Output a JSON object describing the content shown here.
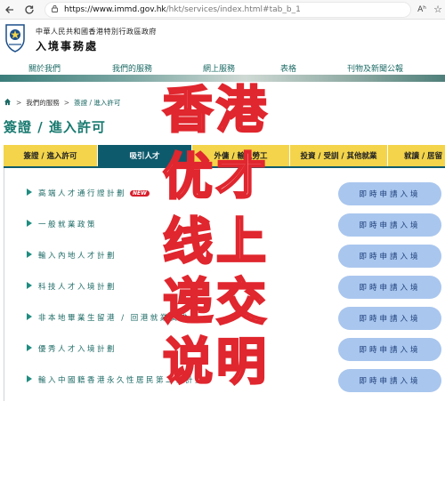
{
  "browser": {
    "url_host": "https://www.immd.gov.hk",
    "url_path": "/hkt/services/index.html#tab_b_1",
    "read_aloud_label": "Aʰ",
    "back_icon": "back-arrow-icon",
    "refresh_icon": "refresh-icon",
    "lock_icon": "lock-icon"
  },
  "header": {
    "government_name": "中華人民共和國香港特別行政區政府",
    "department_name": "入境事務處"
  },
  "nav": {
    "items": [
      {
        "label": "關於我們"
      },
      {
        "label": "我們的服務"
      },
      {
        "label": "網上服務"
      },
      {
        "label": "表格"
      },
      {
        "label": "刊物及新聞公報"
      }
    ]
  },
  "breadcrumb": {
    "items": [
      "我們的服務",
      "簽證 / 進入許可"
    ],
    "separator": ">"
  },
  "page_title": "簽證 / 進入許可",
  "tabs": [
    {
      "label": "簽證 / 進入許可",
      "active": false
    },
    {
      "label": "吸引人才",
      "active": true
    },
    {
      "label": "外傭 / 輸入勞工",
      "active": false
    },
    {
      "label": "投資 / 受訓 / 其他就業",
      "active": false
    },
    {
      "label": "就讀 / 居留",
      "active": false
    }
  ],
  "schemes": [
    {
      "label": "高端人才通行證計劃",
      "new": true,
      "button": "即時申請入境"
    },
    {
      "label": "一般就業政策",
      "new": false,
      "button": "即時申請入境"
    },
    {
      "label": "輸入內地人才計劃",
      "new": false,
      "button": "即時申請入境"
    },
    {
      "label": "科技人才入境計劃",
      "new": false,
      "button": "即時申請入境"
    },
    {
      "label": "非本地畢業生留港 / 回港就業安排",
      "new": false,
      "button": "即時申請入境"
    },
    {
      "label": "優秀人才入境計劃",
      "new": false,
      "button": "即時申請入境"
    },
    {
      "label": "輸入中國籍香港永久性居民第二代計劃",
      "new": false,
      "button": "即時申請入境"
    }
  ],
  "new_badge_text": "NEW",
  "overlay": {
    "chars": [
      "香",
      "港",
      "优",
      "才",
      "线",
      "上",
      "递",
      "交",
      "说",
      "明"
    ],
    "stroke_color": "#e0262e"
  },
  "colors": {
    "accent_teal": "#187a70",
    "tab_yellow": "#f3d44a",
    "tab_active": "#0e5a6d",
    "button_blue": "#a9c6ee"
  }
}
